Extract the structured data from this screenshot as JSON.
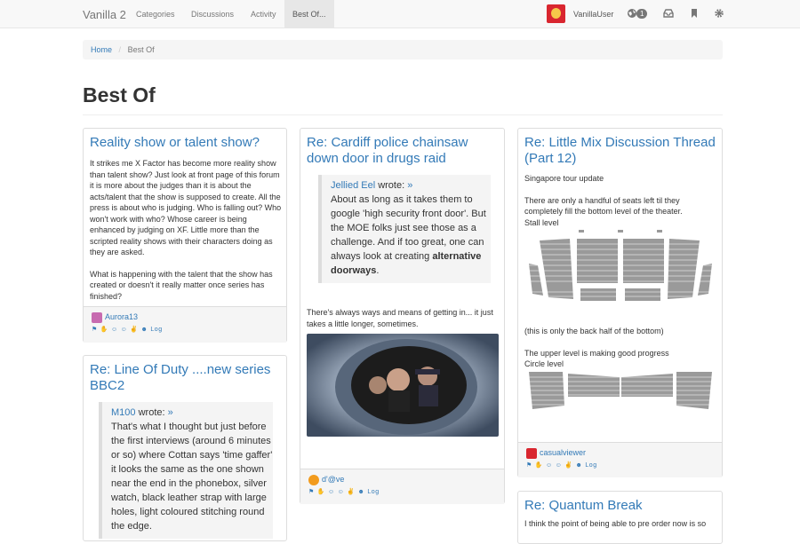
{
  "nav": {
    "brand": "Vanilla 2",
    "links": [
      "Categories",
      "Discussions",
      "Activity",
      "Best Of..."
    ],
    "user": "VanillaUser",
    "notifications": "1",
    "icons": [
      "globe-icon",
      "inbox-icon",
      "bookmark-icon",
      "gear-icon"
    ]
  },
  "breadcrumb": {
    "home": "Home",
    "current": "Best Of"
  },
  "page_title": "Best Of",
  "cards": {
    "reality": {
      "title": "Reality show or talent show?",
      "p1": "It strikes me X Factor has become more reality show than talent show? Just look at front page of this forum it is more about the judges than it is about the acts/talent that the show is supposed to create. All the press is about who is judging. Who is falling out? Who won't work with who? Whose career is being enhanced by judging on XF. Little more than the scripted reality shows with their characters doing as they are asked.",
      "p2": "What is happening with the talent that the show has created or doesn't it really matter once series has finished?",
      "author": "Aurora13",
      "log": "Log"
    },
    "lineofduty": {
      "title": "Re: Line Of Duty ....new series BBC2",
      "quote_author": "M100",
      "quote_wrote": "wrote:",
      "quote_arrow": "»",
      "quote_text": "That's what I thought but just before the first interviews (around 6 minutes or so) where Cottan says 'time gaffer' it looks the same as the one shown near the end in the phonebox, silver watch, black leather strap with large holes, light coloured stitching round the edge."
    },
    "cardiff": {
      "title": "Re: Cardiff police chainsaw down door in drugs raid",
      "quote_author": "Jellied Eel",
      "quote_wrote": "wrote:",
      "quote_arrow": "»",
      "quote_text": "About as long as it takes them to google 'high security front door'. But the MOE folks just see those as a challenge. And if too great, one can always look at creating",
      "quote_bold": "alternative doorways",
      "quote_end": ".",
      "p1": "There's always ways and means of getting in... it just takes a little longer, sometimes.",
      "author": "d'@ve",
      "log": "Log"
    },
    "littlemix": {
      "title": "Re: Little Mix Discussion Thread (Part 12)",
      "p1": "Singapore tour update",
      "p2": "There are only a handful of seats left til they completely fill the bottom level of the theater.",
      "p3": "Stall level",
      "p4": "(this is only the back half of the bottom)",
      "p5": "The upper level is making good progress",
      "p6": "Circle level",
      "author": "casualviewer",
      "log": "Log"
    },
    "quantum": {
      "title": "Re: Quantum Break",
      "p1": "I think the point of being able to pre order now is so"
    }
  },
  "colors": {
    "link": "#337ab7",
    "navbar": "#f8f8f8",
    "footer": "#f5f5f5"
  }
}
